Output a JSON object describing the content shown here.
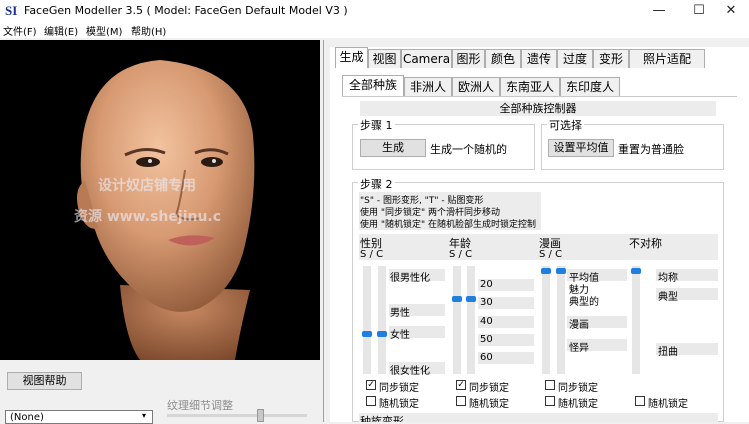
{
  "window": {
    "app_icon_text": "SI",
    "title": "FaceGen Modeller 3.5  ( Model: FaceGen Default Model V3 )",
    "minimize": "—",
    "maximize": "☐",
    "close": "✕"
  },
  "menu": [
    "文件(F)",
    "编辑(E)",
    "模型(M)",
    "帮助(H)"
  ],
  "viewport": {
    "watermark_line1": "设计奴店铺专用",
    "watermark_line2": "资源 www.shejinu.c"
  },
  "left_bottom": {
    "view_help_button": "视图帮助",
    "texture_label": "纹理细节调整",
    "dropdown_value": "(None)"
  },
  "tabs_main": [
    "生成",
    "视图",
    "Camera",
    "图形",
    "颜色",
    "遗传",
    "过度",
    "变形",
    "照片适配"
  ],
  "tabs_sub": [
    "全部种族",
    "非洲人",
    "欧洲人",
    "东南亚人",
    "东印度人"
  ],
  "panel_title": "全部种族控制器",
  "step1": {
    "title": "步骤 1",
    "generate_button": "生成",
    "generate_desc": "生成一个随机的"
  },
  "optional": {
    "title": "可选择",
    "set_average_button": "设置平均值",
    "reset_desc": "重置为普通脸"
  },
  "step2": {
    "title": "步骤 2",
    "hint1": "\"S\" - 图形变形, \"T\" - 贴图变形",
    "hint2": "使用 \"同步锁定\" 两个滑杆同步移动",
    "hint3": "使用 \"随机锁定\" 在随机脸部生成时锁定控制"
  },
  "sliders": {
    "gender": {
      "title": "性别",
      "sc": "S / C",
      "labels": [
        "很男性化",
        "男性",
        "女性",
        "很女性化"
      ],
      "level": 0.62,
      "sync_lock": "同步锁定",
      "sync_checked": true,
      "random_lock": "随机锁定",
      "random_checked": false
    },
    "age": {
      "title": "年龄",
      "sc": "S / C",
      "labels": [
        "20",
        "30",
        "40",
        "50",
        "60"
      ],
      "level": 0.27,
      "sync_lock": "同步锁定",
      "sync_checked": true,
      "random_lock": "随机锁定",
      "random_checked": false
    },
    "caricature": {
      "title": "漫画",
      "sc": "S / C",
      "labels": [
        "平均值",
        "魅力",
        "典型的",
        "漫画",
        "怪异"
      ],
      "level": 0.0,
      "sync_lock": "同步锁定",
      "sync_checked": false,
      "random_lock": "随机锁定",
      "random_checked": false
    },
    "asymmetry": {
      "title": "不对称",
      "labels": [
        "均称",
        "典型",
        "扭曲"
      ],
      "level": 0.0,
      "random_lock": "随机锁定",
      "random_checked": false
    }
  },
  "bottom_partial": "种族变形"
}
